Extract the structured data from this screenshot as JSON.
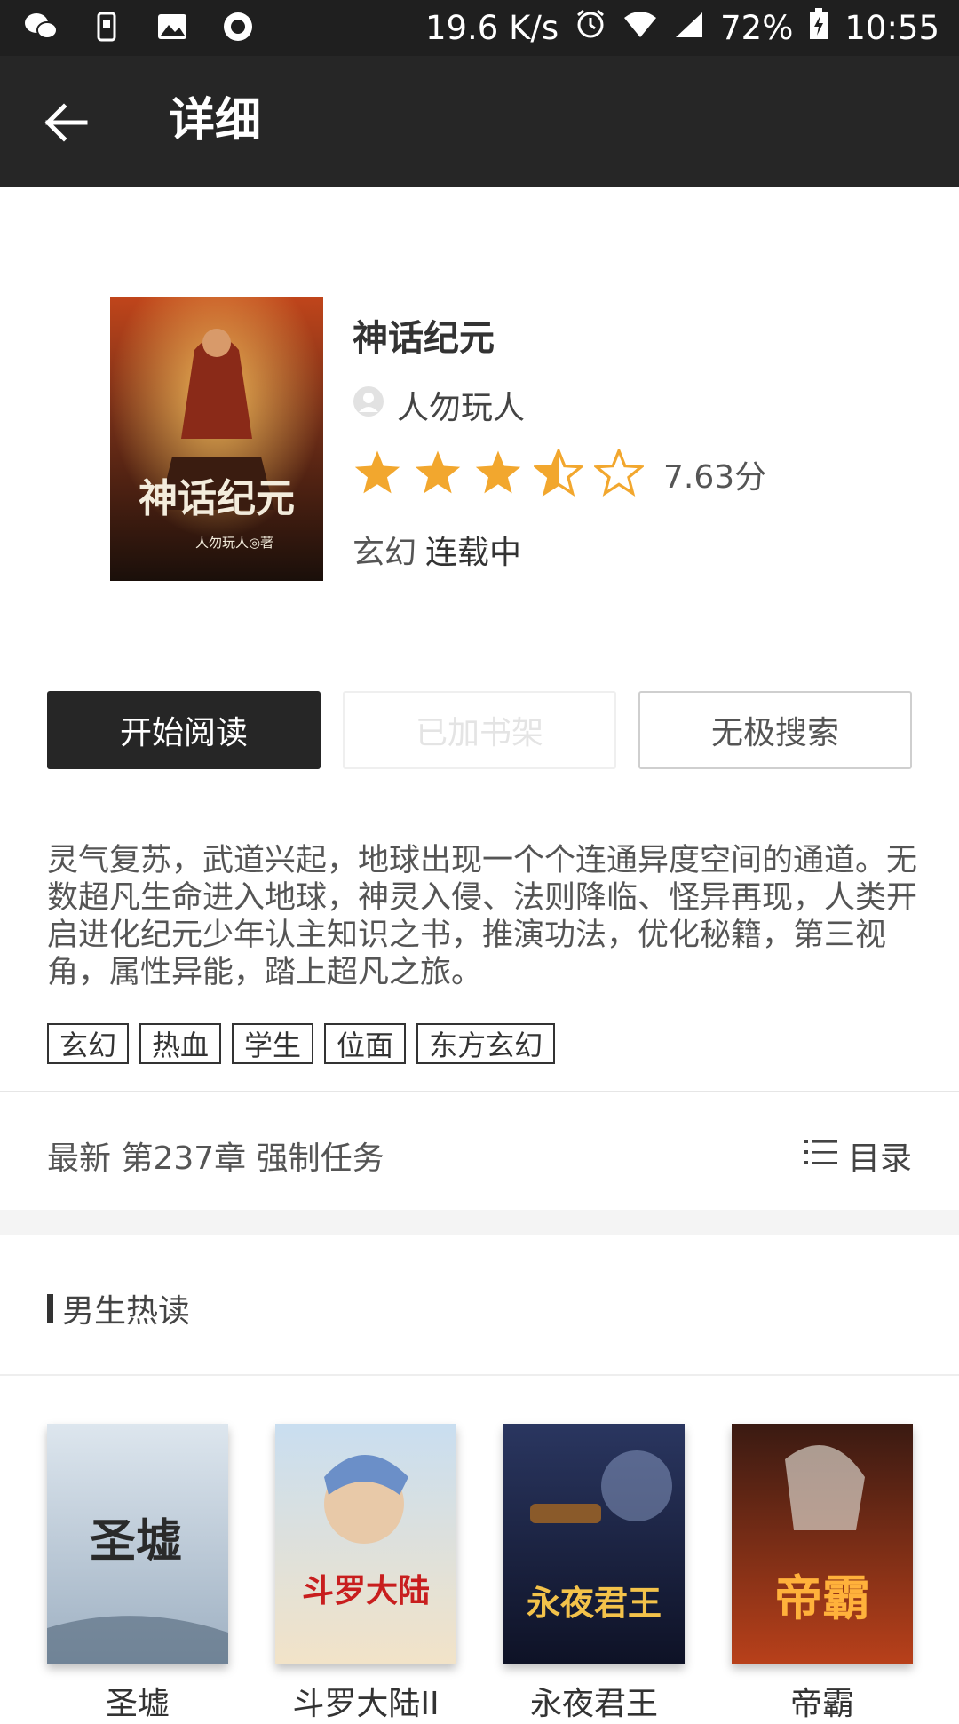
{
  "status_bar": {
    "speed": "19.6 K/s",
    "battery": "72%",
    "time": "10:55",
    "icons": [
      "wechat-icon",
      "sim-icon",
      "image-icon",
      "record-icon",
      "alarm-icon",
      "wifi-icon",
      "signal-icon",
      "battery-icon"
    ]
  },
  "app_bar": {
    "title": "详细",
    "back_icon": "arrow-left-icon"
  },
  "book": {
    "title": "神话纪元",
    "author": "人勿玩人",
    "rating": 3.5,
    "score": "7.63分",
    "genre": "玄幻",
    "status": "连载中",
    "cover_text": "神话纪元",
    "cover_author_text": "人勿玩人◎著"
  },
  "actions": {
    "start_reading": "开始阅读",
    "added_shelf": "已加书架",
    "search": "无极搜索"
  },
  "description": "灵气复苏，武道兴起，地球出现一个个连通异度空间的通道。无数超凡生命进入地球，神灵入侵、法则降临、怪异再现，人类开启进化纪元少年认主知识之书，推演功法，优化秘籍，第三视角，属性异能，踏上超凡之旅。",
  "tags": [
    "玄幻",
    "热血",
    "学生",
    "位面",
    "东方玄幻"
  ],
  "latest": {
    "label": "最新 第237章 强制任务",
    "toc_label": "目录"
  },
  "section": {
    "title": "男生热读"
  },
  "recommendations": [
    {
      "name": "圣墟",
      "cover_text": "圣墟",
      "colors": [
        "#dde6ee",
        "#9eb0c2"
      ],
      "text_color": "#2a2a2a"
    },
    {
      "name": "斗罗大陆II",
      "cover_text": "斗罗大陆",
      "colors": [
        "#c9def0",
        "#f2e3c8"
      ],
      "text_color": "#c81e1e"
    },
    {
      "name": "永夜君王",
      "cover_text": "永夜君王",
      "colors": [
        "#2a3660",
        "#0e1226"
      ],
      "text_color": "#f3c24a"
    },
    {
      "name": "帝霸",
      "cover_text": "帝霸",
      "colors": [
        "#3a1a12",
        "#b8401a"
      ],
      "text_color": "#ffb13b"
    }
  ],
  "colors": {
    "star": "#f2a72e",
    "dark": "#262626"
  }
}
